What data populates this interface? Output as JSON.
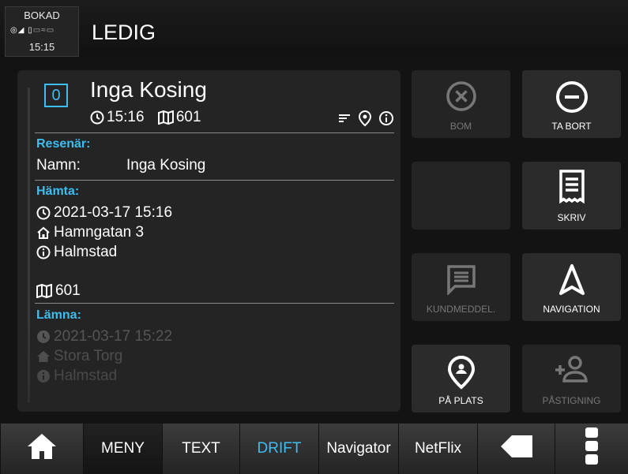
{
  "status": {
    "label": "BOKAD",
    "icons": [
      "gps-icon",
      "signal-icon",
      "phone-icon",
      "car-icon",
      "wifi-icon",
      "battery-icon"
    ],
    "time": "15:15"
  },
  "header": {
    "title": "LEDIG"
  },
  "trip": {
    "order_number": "0",
    "passenger_name": "Inga Kosing",
    "pickup_time": "15:16",
    "area": "601",
    "traveler_section": {
      "heading": "Resenär:",
      "name_label": "Namn:",
      "name_value": "Inga Kosing"
    },
    "pickup_section": {
      "heading": "Hämta:",
      "datetime": "2021-03-17 15:16",
      "address": "Hamngatan 3",
      "city": "Halmstad",
      "area": "601"
    },
    "dropoff_section": {
      "heading": "Lämna:",
      "datetime": "2021-03-17 15:22",
      "address": "Stora Torg",
      "city": "Halmstad"
    }
  },
  "actions": {
    "bom": "BOM",
    "ta_bort": "TA BORT",
    "skriv": "SKRIV",
    "kundmeddel": "KUNDMEDDEL.",
    "navigation": "NAVIGATION",
    "pa_plats": "PÅ PLATS",
    "pastigning": "PÅSTIGNING"
  },
  "bottom_nav": {
    "items": [
      "MENY",
      "TEXT",
      "DRIFT",
      "Navigator",
      "NetFlix"
    ],
    "selected": "DRIFT"
  },
  "colors": {
    "accent": "#3dbdf0",
    "background": "#131313",
    "panel": "#242424",
    "disabled": "#777777"
  }
}
